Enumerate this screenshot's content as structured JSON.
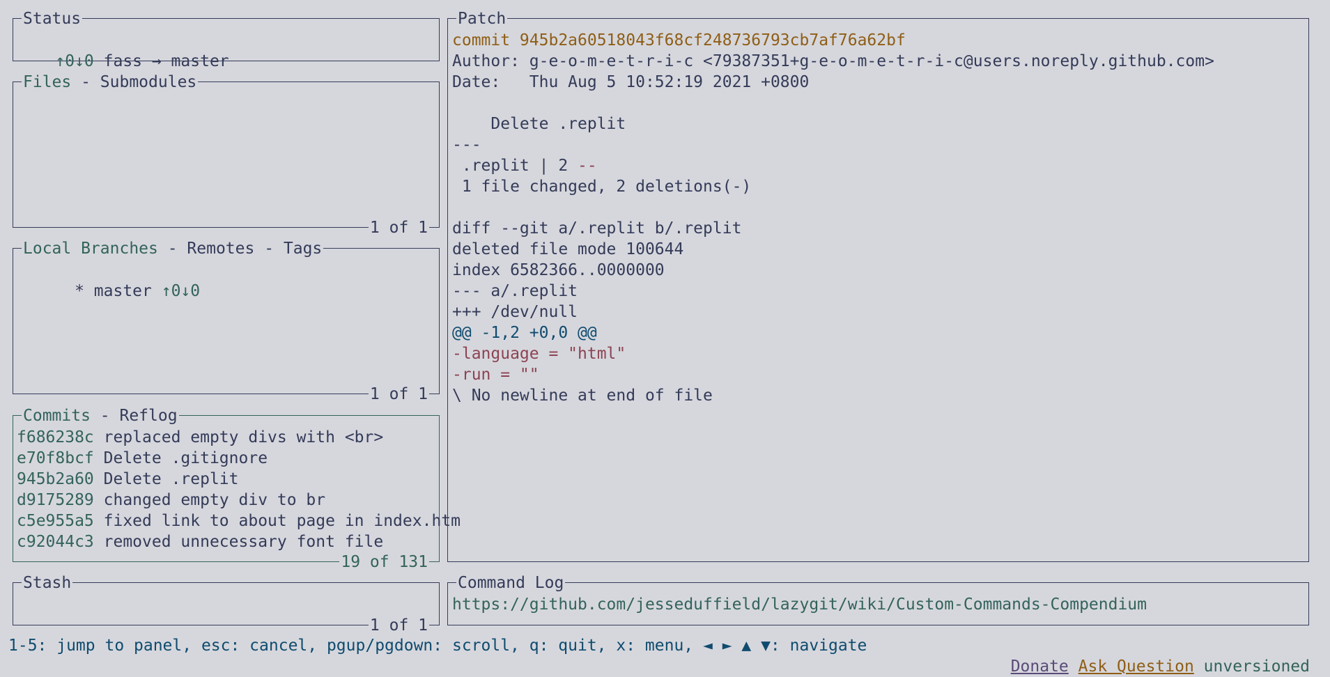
{
  "status": {
    "title": "Status",
    "arrows": "↑0↓0",
    "text": " fass → master"
  },
  "files": {
    "title_active": "Files",
    "title_rest": " - Submodules",
    "footer": "1 of 1"
  },
  "branches": {
    "title_active": "Local Branches",
    "title_rest": " - Remotes - Tags",
    "items": [
      {
        "prefix": "  * master ",
        "arrows": "↑0↓0"
      }
    ],
    "footer": "1 of 1"
  },
  "commits": {
    "title_active": "Commits",
    "title_rest": " - Reflog",
    "items": [
      {
        "sha": "f686238c",
        "msg": "replaced empty divs with <br>"
      },
      {
        "sha": "e70f8bcf",
        "msg": "Delete .gitignore"
      },
      {
        "sha": "945b2a60",
        "msg": "Delete .replit"
      },
      {
        "sha": "d9175289",
        "msg": "changed empty div to br"
      },
      {
        "sha": "c5e955a5",
        "msg": "fixed link to about page in index.htm"
      },
      {
        "sha": "c92044c3",
        "msg": "removed unnecessary font file"
      }
    ],
    "footer": "19 of 131"
  },
  "stash": {
    "title": "Stash",
    "footer": "1 of 1"
  },
  "patch": {
    "title": "Patch",
    "commit_line": "commit 945b2a60518043f68cf248736793cb7af76a62bf",
    "author_line": "Author: g-e-o-m-e-t-r-i-c <79387351+g-e-o-m-e-t-r-i-c@users.noreply.github.com>",
    "date_line": "Date:   Thu Aug 5 10:52:19 2021 +0800",
    "message": "    Delete .replit",
    "sep": "---",
    "stat_file": " .replit | 2 ",
    "stat_minus": "--",
    "summary": " 1 file changed, 2 deletions(-)",
    "diff_header": "diff --git a/.replit b/.replit",
    "deleted_mode": "deleted file mode 100644",
    "index_line": "index 6582366..0000000",
    "minus_file": "--- a/.replit",
    "plus_file": "+++ /dev/null",
    "hunk": "@@ -1,2 +0,0 @@",
    "removed_1": "-language = \"html\"",
    "removed_2": "-run = \"\"",
    "no_newline": "\\ No newline at end of file"
  },
  "command_log": {
    "title": "Command Log",
    "url": "https://github.com/jesseduffield/lazygit/wiki/Custom-Commands-Compendium"
  },
  "footer": {
    "help": "1-5: jump to panel, esc: cancel, pgup/pgdown: scroll, q: quit, x: menu, ◄ ► ▲ ▼: navigate",
    "donate": "Donate",
    "ask": "Ask Question",
    "version": "unversioned"
  },
  "colors": {
    "background": "#d6d7dd",
    "text": "#343b58",
    "green": "#33635c",
    "orange": "#8f5e15",
    "red": "#8c4351",
    "blue": "#0f4b6e"
  }
}
